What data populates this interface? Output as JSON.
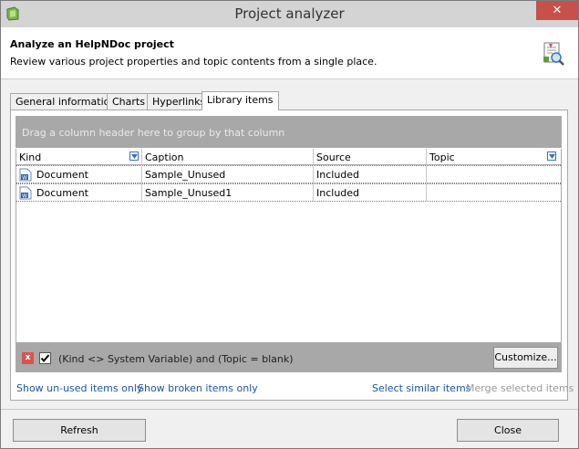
{
  "window": {
    "title": "Project analyzer",
    "close_label": "✕"
  },
  "header": {
    "title": "Analyze an HelpNDoc project",
    "description": "Review various project properties and topic contents from a single place."
  },
  "tabs": [
    {
      "label": "General information",
      "active": false
    },
    {
      "label": "Charts",
      "active": false
    },
    {
      "label": "Hyperlinks",
      "active": false
    },
    {
      "label": "Library items",
      "active": true
    }
  ],
  "grid": {
    "group_hint": "Drag a column header here to group by that column",
    "columns": [
      "Kind",
      "Caption",
      "Source",
      "Topic"
    ],
    "rows": [
      {
        "kind": "Document",
        "caption": "Sample_Unused",
        "source": "Included",
        "topic": ""
      },
      {
        "kind": "Document",
        "caption": "Sample_Unused1",
        "source": "Included",
        "topic": ""
      }
    ],
    "filter_text": "(Kind <> System Variable) and (Topic = blank)",
    "filter_clear_label": "x",
    "customize_label": "Customize..."
  },
  "links": {
    "show_unused": "Show un-used items only",
    "show_broken": "Show broken items only",
    "select_similar": "Select similar items",
    "merge_selected": "Merge selected items"
  },
  "footer": {
    "refresh_label": "Refresh",
    "close_label": "Close"
  },
  "colors": {
    "link": "#1a55b0",
    "disabled_link": "#9a9a9a",
    "group_area": "#a8a8a8",
    "close_button": "#c7504b"
  }
}
